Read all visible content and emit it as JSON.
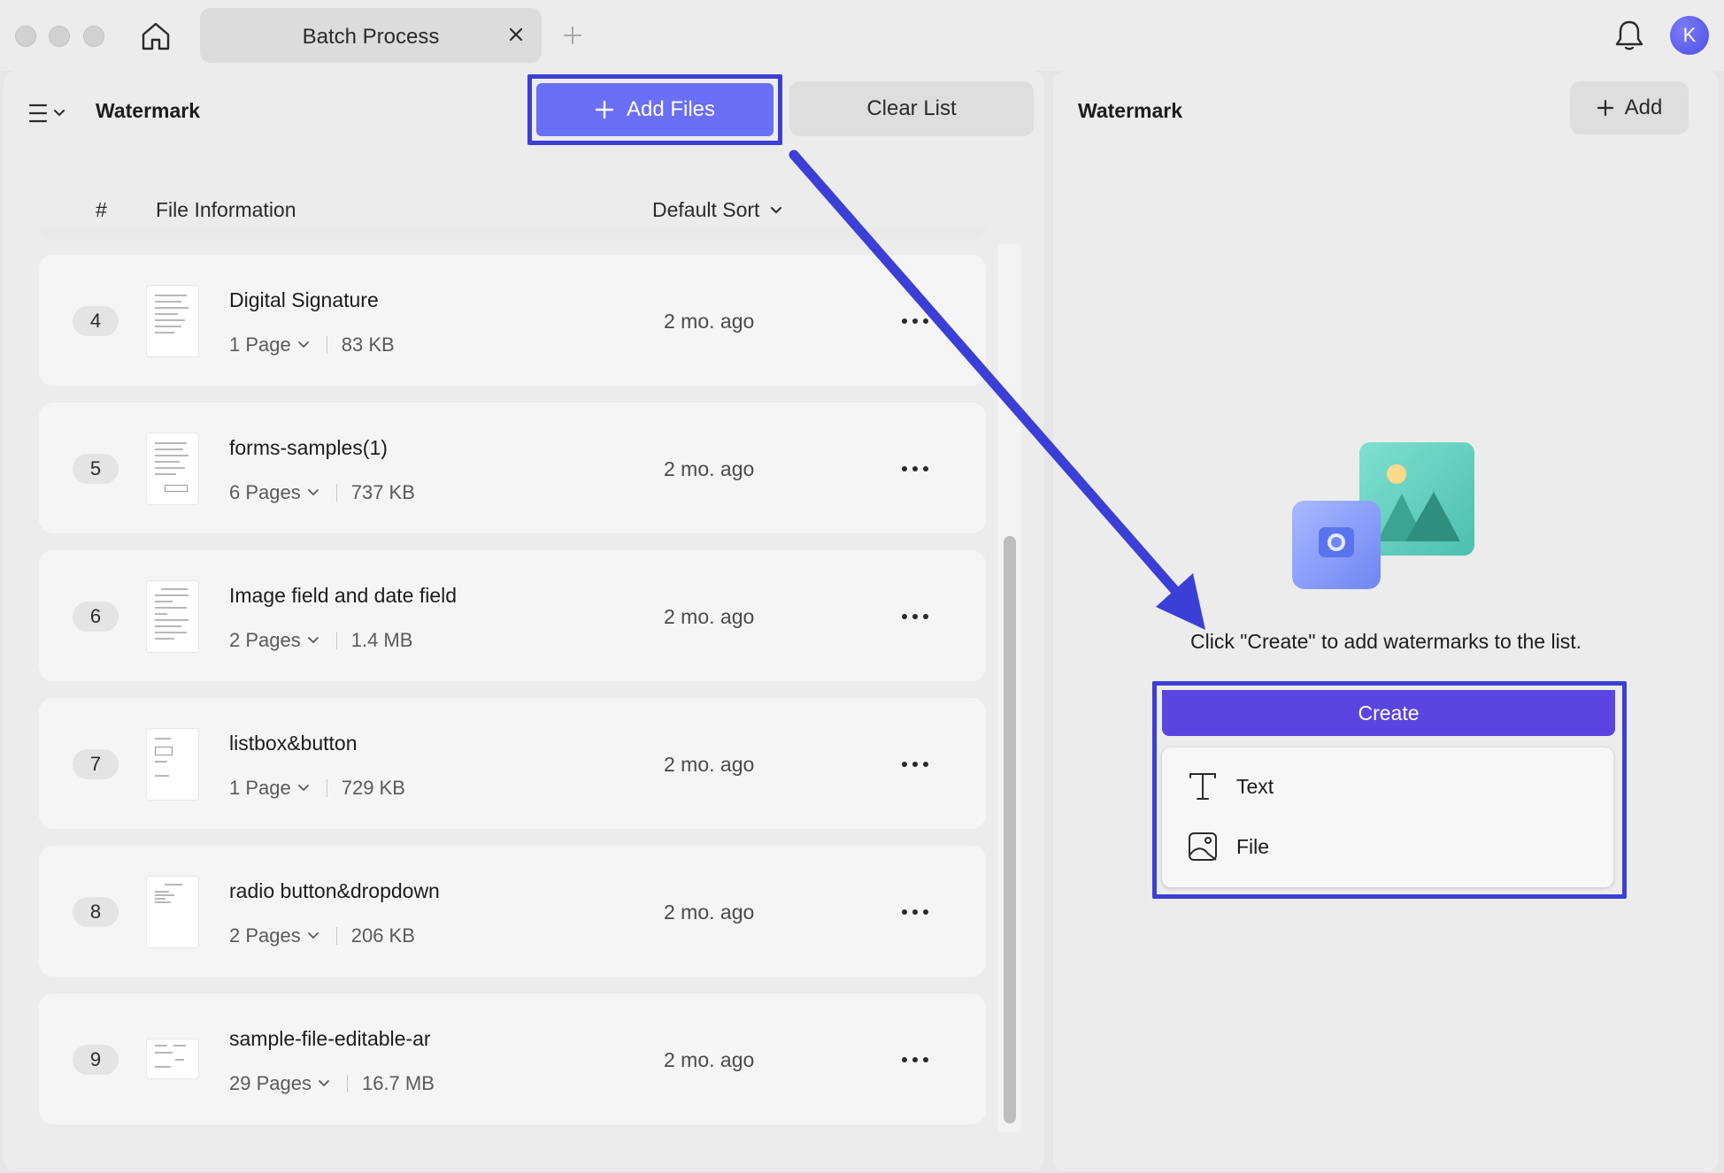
{
  "titlebar": {
    "tab_label": "Batch Process",
    "avatar_initial": "K"
  },
  "left_panel": {
    "title": "Watermark",
    "add_files_label": "Add Files",
    "clear_list_label": "Clear List",
    "columns": {
      "index": "#",
      "file_info": "File Information",
      "sort": "Default Sort"
    },
    "files": [
      {
        "index": "4",
        "name": "Digital Signature",
        "pages": "1 Page",
        "size": "83 KB",
        "date": "2 mo. ago"
      },
      {
        "index": "5",
        "name": "forms-samples(1)",
        "pages": "6 Pages",
        "size": "737 KB",
        "date": "2 mo. ago"
      },
      {
        "index": "6",
        "name": "Image field and date field",
        "pages": "2 Pages",
        "size": "1.4 MB",
        "date": "2 mo. ago"
      },
      {
        "index": "7",
        "name": "listbox&button",
        "pages": "1 Page",
        "size": "729 KB",
        "date": "2 mo. ago"
      },
      {
        "index": "8",
        "name": "radio button&dropdown",
        "pages": "2 Pages",
        "size": "206 KB",
        "date": "2 mo. ago"
      },
      {
        "index": "9",
        "name": "sample-file-editable-ar",
        "pages": "29 Pages",
        "size": "16.7 MB",
        "date": "2 mo. ago"
      }
    ]
  },
  "right_panel": {
    "title": "Watermark",
    "add_label": "Add",
    "hint": "Click \"Create\" to add watermarks to the list.",
    "create_label": "Create",
    "menu": {
      "text_label": "Text",
      "file_label": "File"
    }
  },
  "colors": {
    "accent": "#6a6ff5",
    "create": "#5b45e0",
    "annotation": "#3b3fd6"
  },
  "icons": [
    "home-icon",
    "close-icon",
    "plus-icon",
    "bell-icon",
    "menu-icon",
    "chevron-down-icon",
    "more-icon",
    "text-icon",
    "image-file-icon"
  ]
}
